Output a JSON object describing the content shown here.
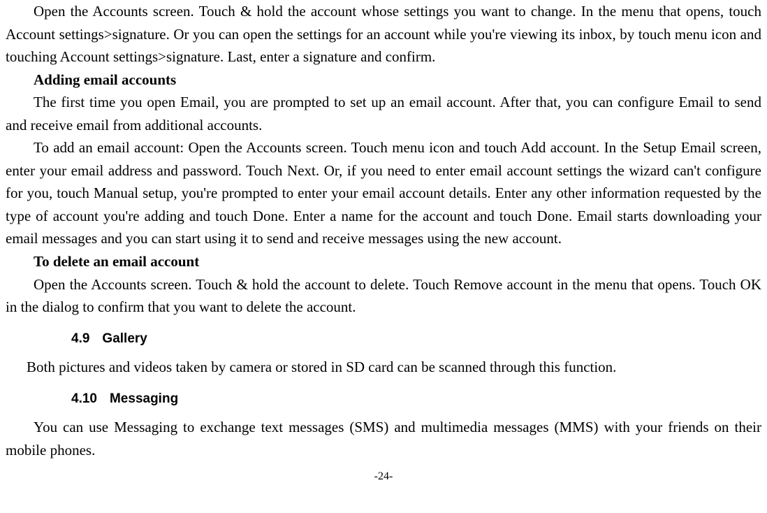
{
  "para1": "Open the Accounts screen. Touch & hold the account whose settings you want to change. In the menu that opens, touch Account settings>signature. Or you can open the settings for an account while you're viewing its inbox, by touch menu icon and touching Account settings>signature. Last, enter a signature and confirm.",
  "heading1": "Adding email accounts",
  "para2": "The first time you open Email, you are prompted to set up an email account. After that, you can configure Email to send and receive email from additional accounts.",
  "para3": "To add an email account: Open the Accounts screen. Touch menu icon and touch Add account. In the Setup Email screen, enter your email address and password. Touch Next. Or, if you need to enter email account settings the wizard can't configure for you, touch Manual setup, you're prompted to enter your email account details. Enter any other information requested by the type of account you're adding and touch Done. Enter a name for the account and touch Done. Email starts downloading your email messages and you can start using it to send and receive messages using the new account.",
  "heading2": "To delete an email account",
  "para4": "Open the Accounts screen. Touch & hold the account to delete. Touch Remove account in the menu that opens. Touch OK in the dialog to confirm that you want to delete the account.",
  "section49_num": "4.9",
  "section49_title": "Gallery",
  "para5": "Both pictures and videos taken by camera or stored in SD card can be scanned through this function.",
  "section410_num": "4.10",
  "section410_title": "Messaging",
  "para6": "You can use Messaging to exchange text messages (SMS) and multimedia messages (MMS) with your friends on their mobile phones.",
  "page_number": "-24-"
}
